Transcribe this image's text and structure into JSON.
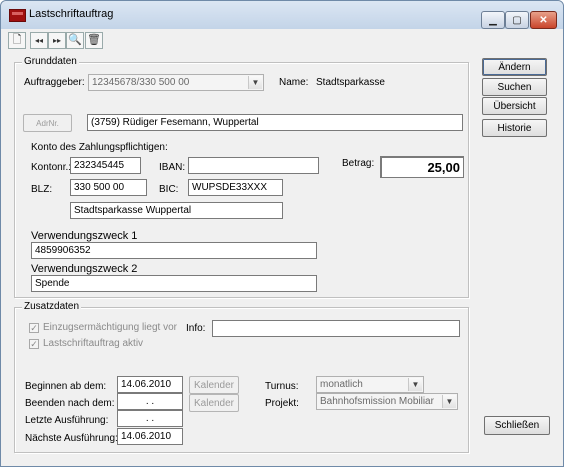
{
  "window": {
    "title": "Lastschriftauftrag",
    "controls": {
      "minimize": "▁",
      "maximize": "▢",
      "close": "✕"
    }
  },
  "toolbar": [
    {
      "icon": "new-document-icon",
      "glyph": "🗋"
    },
    {
      "icon": "first-record-icon",
      "glyph": "◂◂"
    },
    {
      "icon": "last-record-icon",
      "glyph": "▸▸"
    },
    {
      "icon": "search-icon",
      "glyph": "🔍"
    },
    {
      "icon": "delete-trash-icon",
      "glyph": "🗑"
    }
  ],
  "grunddaten": {
    "legend": "Grunddaten",
    "auftraggeber_label": "Auftraggeber:",
    "auftraggeber_value": "12345678/330 500 00",
    "name_label": "Name:",
    "name_value": "Stadtsparkasse",
    "adrnr_button": "AdrNr.",
    "adresse_value": "(3759) Rüdiger Fesemann, Wuppertal",
    "konto_heading": "Konto des Zahlungspflichtigen:",
    "kontonr_label": "Kontonr.:",
    "kontonr_value": "232345445",
    "iban_label": "IBAN:",
    "iban_value": "",
    "betrag_label": "Betrag:",
    "betrag_value": "25,00",
    "blz_label": "BLZ:",
    "blz_value": "330 500 00",
    "bic_label": "BIC:",
    "bic_value": "WUPSDE33XXX",
    "bank_value": "Stadtsparkasse Wuppertal",
    "vz1_label": "Verwendungszweck 1",
    "vz1_value": "4859906352",
    "vz2_label": "Verwendungszweck 2",
    "vz2_value": "Spende"
  },
  "zusatzdaten": {
    "legend": "Zusatzdaten",
    "einzug_label": "Einzugsermächtigung liegt vor",
    "einzug_checked": true,
    "aktiv_label": "Lastschriftauftrag aktiv",
    "aktiv_checked": true,
    "info_label": "Info:",
    "info_value": "",
    "beginn_label": "Beginnen ab dem:",
    "beginn_value": "14.06.2010",
    "ende_label": "Beenden nach dem:",
    "ende_value": ". .",
    "letzte_label": "Letzte Ausführung:",
    "letzte_value": ". .",
    "naechste_label": "Nächste Ausführung:",
    "naechste_value": "14.06.2010",
    "kalender_label": "Kalender",
    "turnus_label": "Turnus:",
    "turnus_value": "monatlich",
    "projekt_label": "Projekt:",
    "projekt_value": "Bahnhofsmission Mobiliar"
  },
  "sidebar": {
    "aendern": "Ändern",
    "suchen": "Suchen",
    "uebersicht": "Übersicht",
    "historie": "Historie",
    "schliessen": "Schließen"
  },
  "colors": {
    "titlebar": "#c3d4e8",
    "window_bg": "#f0f0f0",
    "close_button": "#c9452c"
  }
}
